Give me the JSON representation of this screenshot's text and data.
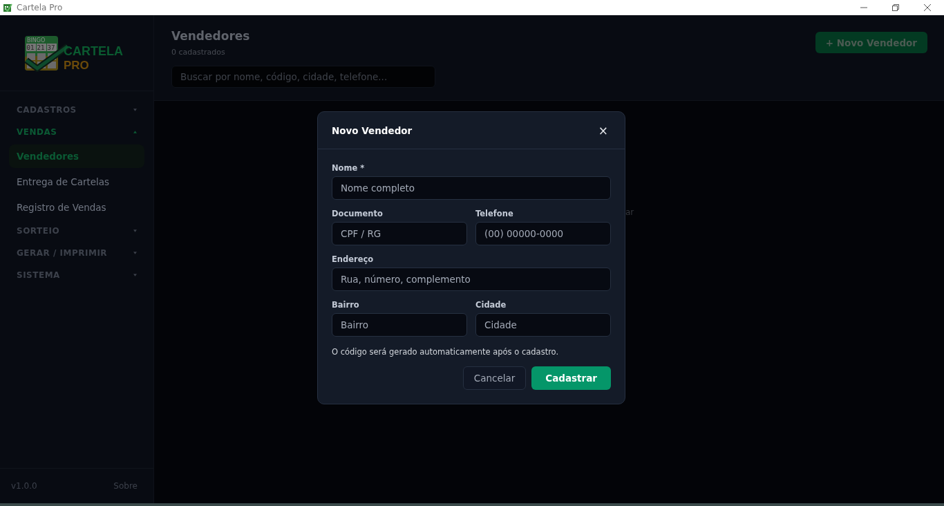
{
  "window": {
    "title": "Cartela Pro"
  },
  "logo": {
    "card_label": "BINGO",
    "numbers": [
      "01",
      "21",
      "37"
    ],
    "name_top": "CARTELA",
    "name_bottom": "PRO"
  },
  "sidebar": {
    "sections": [
      {
        "label": "CADASTROS",
        "expanded": false
      },
      {
        "label": "VENDAS",
        "expanded": true,
        "items": [
          {
            "label": "Vendedores",
            "selected": true
          },
          {
            "label": "Entrega de Cartelas",
            "selected": false
          },
          {
            "label": "Registro de Vendas",
            "selected": false
          }
        ]
      },
      {
        "label": "SORTEIO",
        "expanded": false
      },
      {
        "label": "GERAR / IMPRIMIR",
        "expanded": false
      },
      {
        "label": "SISTEMA",
        "expanded": false
      }
    ],
    "version": "v1.0.0",
    "about_link": "Sobre"
  },
  "page": {
    "title": "Vendedores",
    "subtitle": "0 cadastrados",
    "search": {
      "placeholder": "Buscar por nome, código, cidade, telefone..."
    },
    "new_button": "+ Novo Vendedor",
    "hidden_text_fragment": "ar"
  },
  "dialog": {
    "title": "Novo Vendedor",
    "close": "×",
    "rows": [
      [
        {
          "label": "Nome *",
          "placeholder": "Nome completo"
        }
      ],
      [
        {
          "label": "Documento",
          "placeholder": "CPF / RG"
        },
        {
          "label": "Telefone",
          "placeholder": "(00) 00000-0000"
        }
      ],
      [
        {
          "label": "Endereço",
          "placeholder": "Rua, número, complemento"
        }
      ],
      [
        {
          "label": "Bairro",
          "placeholder": "Bairro"
        },
        {
          "label": "Cidade",
          "placeholder": "Cidade"
        }
      ]
    ],
    "note": "O código será gerado automaticamente após o cadastro.",
    "cancel_button": "Cancelar",
    "submit_button": "Cadastrar"
  }
}
